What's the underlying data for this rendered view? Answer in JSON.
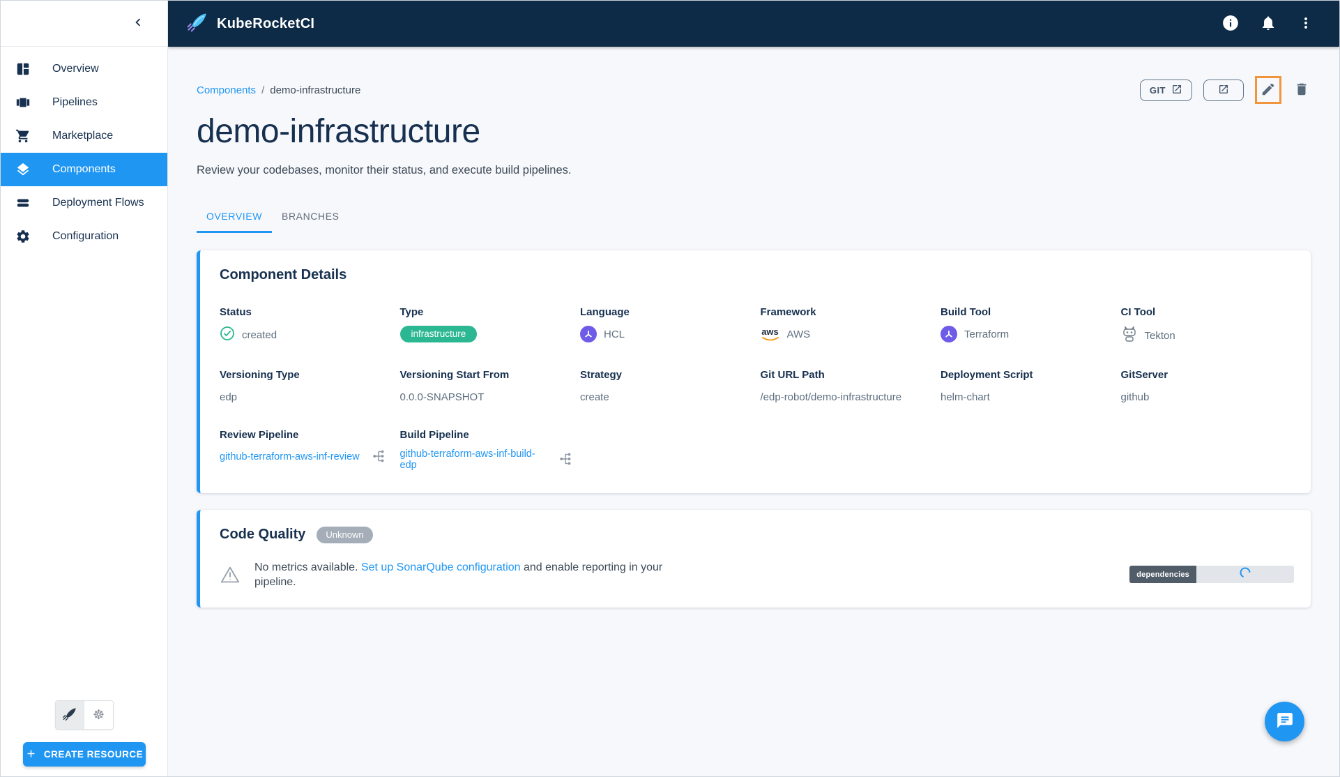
{
  "app_bar": {
    "title": "KubeRocketCI",
    "actions": [
      {
        "name": "info",
        "icon": "info-icon"
      },
      {
        "name": "notifications",
        "icon": "bell-icon"
      },
      {
        "name": "more",
        "icon": "more-vert-icon"
      }
    ]
  },
  "sidebar": {
    "items": [
      {
        "label": "Overview",
        "icon": "dashboard-icon",
        "selected": false
      },
      {
        "label": "Pipelines",
        "icon": "pipelines-icon",
        "selected": false
      },
      {
        "label": "Marketplace",
        "icon": "cart-icon",
        "selected": false
      },
      {
        "label": "Components",
        "icon": "layers-icon",
        "selected": true
      },
      {
        "label": "Deployment Flows",
        "icon": "flows-icon",
        "selected": false
      },
      {
        "label": "Configuration",
        "icon": "gear-icon",
        "selected": false
      }
    ],
    "footer": {
      "create_button_label": "CREATE RESOURCE"
    }
  },
  "breadcrumb": {
    "root": "Components",
    "separator": "/",
    "current": "demo-infrastructure"
  },
  "page": {
    "title": "demo-infrastructure",
    "subtitle": "Review your codebases, monitor their status, and execute build pipelines.",
    "git_button_label": "GIT"
  },
  "tabs": [
    {
      "label": "OVERVIEW",
      "active": true
    },
    {
      "label": "BRANCHES",
      "active": false
    }
  ],
  "component_details": {
    "title": "Component Details",
    "aws_logo_text": "aws",
    "fields": [
      {
        "label": "Status",
        "value": "created",
        "kind": "status"
      },
      {
        "label": "Type",
        "value": "infrastructure",
        "kind": "chip"
      },
      {
        "label": "Language",
        "value": "HCL",
        "kind": "terraform-icon"
      },
      {
        "label": "Framework",
        "value": "AWS",
        "kind": "aws-icon"
      },
      {
        "label": "Build Tool",
        "value": "Terraform",
        "kind": "terraform-icon"
      },
      {
        "label": "CI Tool",
        "value": "Tekton",
        "kind": "tekton-icon"
      },
      {
        "label": "Versioning Type",
        "value": "edp",
        "kind": "text"
      },
      {
        "label": "Versioning Start From",
        "value": "0.0.0-SNAPSHOT",
        "kind": "text"
      },
      {
        "label": "Strategy",
        "value": "create",
        "kind": "text"
      },
      {
        "label": "Git URL Path",
        "value": "/edp-robot/demo-infrastructure",
        "kind": "text"
      },
      {
        "label": "Deployment Script",
        "value": "helm-chart",
        "kind": "text"
      },
      {
        "label": "GitServer",
        "value": "github",
        "kind": "text"
      },
      {
        "label": "Review Pipeline",
        "value": "github-terraform-aws-inf-review",
        "kind": "link"
      },
      {
        "label": "Build Pipeline",
        "value": "github-terraform-aws-inf-build-edp",
        "kind": "link"
      }
    ]
  },
  "code_quality": {
    "title": "Code Quality",
    "status_chip": "Unknown",
    "message_prefix": "No metrics available. ",
    "message_link": "Set up SonarQube configuration",
    "message_suffix": " and enable reporting in your pipeline.",
    "badge_label": "dependencies"
  },
  "colors": {
    "accent": "#2096f3",
    "app_bar": "#0d2a47",
    "heading": "#17304f",
    "status_green": "#2ab791",
    "terraform_purple": "#6e5ce8",
    "highlight_orange": "#f0953c",
    "slate_icon": "#56687a",
    "badge_dark": "#515c69"
  }
}
